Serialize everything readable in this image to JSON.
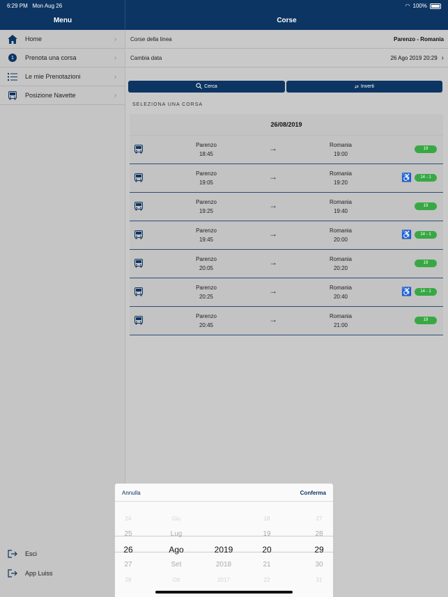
{
  "status": {
    "time": "6:29 PM",
    "date": "Mon Aug 26",
    "battery": "100%"
  },
  "header": {
    "menu_title": "Menu",
    "main_title": "Corse"
  },
  "sidebar": {
    "items": [
      {
        "label": "Home",
        "icon": "home-icon"
      },
      {
        "label": "Prenota una corsa",
        "icon": "numbered-circle-icon",
        "badge": "1"
      },
      {
        "label": "Le mie Prenotazioni",
        "icon": "list-icon"
      },
      {
        "label": "Posizione Navette",
        "icon": "bus-icon"
      }
    ],
    "bottom": [
      {
        "label": "Esci",
        "icon": "logout-icon"
      },
      {
        "label": "App Luiss",
        "icon": "external-app-icon"
      }
    ]
  },
  "main": {
    "line_label": "Corse della linea",
    "line_value": "Parenzo - Romania",
    "date_label": "Cambia data",
    "date_value": "26 Ago 2019 20:29",
    "search_button": "Cerca",
    "invert_button": "Inverti",
    "section_label": "SELEZIONA UNA CORSA",
    "trips_date": "26/08/2019",
    "trips": [
      {
        "from": "Parenzo",
        "depart": "18:45",
        "to": "Romania",
        "arrive": "19:00",
        "seats": "19",
        "accessible": false
      },
      {
        "from": "Parenzo",
        "depart": "19:05",
        "to": "Romania",
        "arrive": "19:20",
        "seats": "14 - 1",
        "accessible": true
      },
      {
        "from": "Parenzo",
        "depart": "19:25",
        "to": "Romania",
        "arrive": "19:40",
        "seats": "19",
        "accessible": false
      },
      {
        "from": "Parenzo",
        "depart": "19:45",
        "to": "Romania",
        "arrive": "20:00",
        "seats": "14 - 1",
        "accessible": true
      },
      {
        "from": "Parenzo",
        "depart": "20:05",
        "to": "Romania",
        "arrive": "20:20",
        "seats": "19",
        "accessible": false
      },
      {
        "from": "Parenzo",
        "depart": "20:25",
        "to": "Romania",
        "arrive": "20:40",
        "seats": "14 - 1",
        "accessible": true
      },
      {
        "from": "Parenzo",
        "depart": "20:45",
        "to": "Romania",
        "arrive": "21:00",
        "seats": "19",
        "accessible": false
      }
    ]
  },
  "picker": {
    "cancel": "Annulla",
    "confirm": "Conferma",
    "columns": [
      [
        "24",
        "25",
        "26",
        "27",
        "28"
      ],
      [
        "Giu",
        "Lug",
        "Ago",
        "Set",
        "Ott"
      ],
      [
        "",
        "",
        "2019",
        "2018",
        "2017"
      ],
      [
        "18",
        "19",
        "20",
        "21",
        "22"
      ],
      [
        "27",
        "28",
        "29",
        "30",
        "31"
      ]
    ]
  },
  "colors": {
    "brand": "#0d3563",
    "seats_badge": "#38a845"
  }
}
